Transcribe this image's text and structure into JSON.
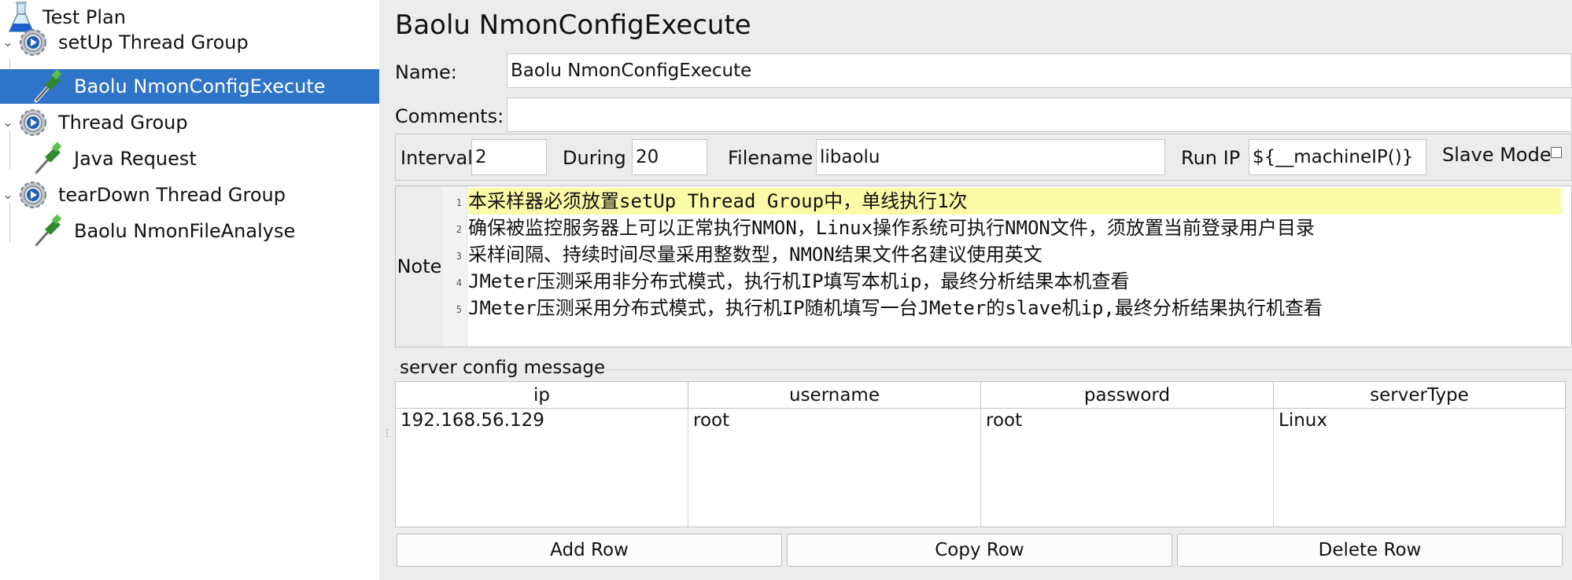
{
  "tree": {
    "items": [
      {
        "label": "Test Plan",
        "icon": "flask-icon"
      },
      {
        "label": "setUp Thread Group",
        "icon": "gear-icon",
        "expanded": true
      },
      {
        "label": "Baolu NmonConfigExecute",
        "icon": "pipette-icon",
        "selected": true
      },
      {
        "label": "Thread Group",
        "icon": "gear-icon",
        "expanded": true
      },
      {
        "label": "Java Request",
        "icon": "pipette-icon"
      },
      {
        "label": "tearDown Thread Group",
        "icon": "gear-icon",
        "expanded": true
      },
      {
        "label": "Baolu NmonFileAnalyse",
        "icon": "pipette-icon"
      }
    ]
  },
  "panel": {
    "title": "Baolu NmonConfigExecute",
    "name_label": "Name:",
    "name_value": "Baolu NmonConfigExecute",
    "comments_label": "Comments:",
    "comments_value": "",
    "interval_label": "Interval",
    "interval_value": "2",
    "during_label": "During",
    "during_value": "20",
    "filename_label": "Filename",
    "filename_value": "libaolu",
    "runip_label": "Run IP",
    "runip_value": "${__machineIP()}",
    "slave_label": "Slave Mode",
    "slave_checked": false,
    "note_label": "Note",
    "note_lines": [
      "本采样器必须放置setUp Thread Group中，单线执行1次",
      "确保被监控服务器上可以正常执行NMON，Linux操作系统可执行NMON文件，须放置当前登录用户目录",
      "采样间隔、持续时间尽量采用整数型，NMON结果文件名建议使用英文",
      "JMeter压测采用非分布式模式，执行机IP填写本机ip，最终分析结果本机查看",
      "JMeter压测采用分布式模式，执行机IP随机填写一台JMeter的slave机ip,最终分析结果执行机查看"
    ],
    "line_numbers": [
      "1",
      "2",
      "3",
      "4",
      "5"
    ]
  },
  "server_config": {
    "legend": "server config message",
    "columns": [
      "ip",
      "username",
      "password",
      "serverType"
    ],
    "rows": [
      [
        "192.168.56.129",
        "root",
        "root",
        "Linux"
      ]
    ],
    "buttons": {
      "add": "Add Row",
      "copy": "Copy Row",
      "delete": "Delete Row"
    }
  },
  "colors": {
    "selection": "#2e74c8",
    "current_line": "#fbfaa7",
    "panel_bg": "#ececec"
  }
}
